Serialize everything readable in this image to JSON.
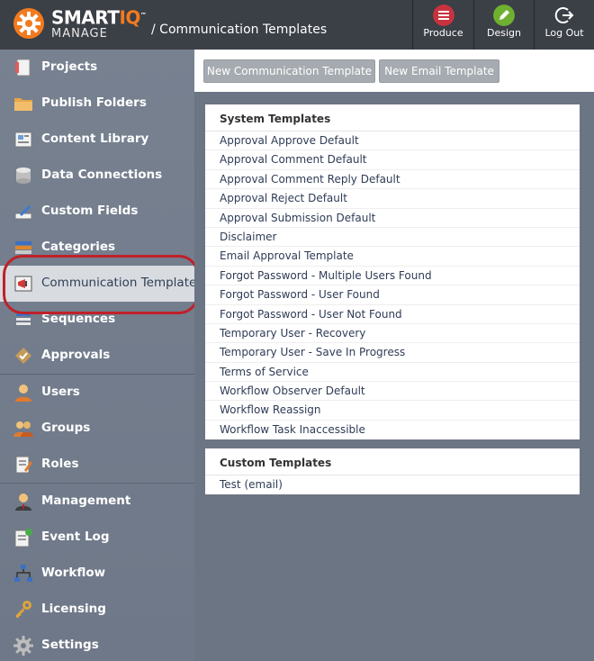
{
  "app": {
    "brand_main": "SMART",
    "brand_iq": "IQ",
    "brand_tm": "™",
    "brand_sub": "MANAGE",
    "page_title": "/ Communication Templates"
  },
  "header_buttons": [
    {
      "label": "Produce",
      "icon": "produce-icon",
      "color": "#c8323f"
    },
    {
      "label": "Design",
      "icon": "design-pencil-icon",
      "color": "#6fb030"
    },
    {
      "label": "Log Out",
      "icon": "logout-icon",
      "color": "#3b3f46"
    }
  ],
  "sidebar": {
    "items": [
      {
        "label": "Projects",
        "icon": "projects-icon"
      },
      {
        "label": "Publish Folders",
        "icon": "folder-icon"
      },
      {
        "label": "Content Library",
        "icon": "content-library-icon"
      },
      {
        "label": "Data Connections",
        "icon": "database-icon"
      },
      {
        "label": "Custom Fields",
        "icon": "custom-fields-icon"
      },
      {
        "label": "Categories",
        "icon": "categories-icon"
      },
      {
        "label": "Communication Templates",
        "icon": "megaphone-icon",
        "active": true
      },
      {
        "label": "Sequences",
        "icon": "sequences-icon"
      },
      {
        "label": "Approvals",
        "icon": "approvals-icon"
      },
      {
        "label": "Users",
        "icon": "user-icon"
      },
      {
        "label": "Groups",
        "icon": "groups-icon"
      },
      {
        "label": "Roles",
        "icon": "roles-icon"
      },
      {
        "label": "Management",
        "icon": "management-icon"
      },
      {
        "label": "Event Log",
        "icon": "event-log-icon"
      },
      {
        "label": "Workflow",
        "icon": "workflow-icon"
      },
      {
        "label": "Licensing",
        "icon": "key-icon"
      },
      {
        "label": "Settings",
        "icon": "gear-icon"
      }
    ]
  },
  "toolbar": {
    "new_comm_label": "New Communication Template",
    "new_email_label": "New Email Template"
  },
  "system_templates": {
    "title": "System Templates",
    "items": [
      "Approval Approve Default",
      "Approval Comment Default",
      "Approval Comment Reply Default",
      "Approval Reject Default",
      "Approval Submission Default",
      "Disclaimer",
      "Email Approval Template",
      "Forgot Password - Multiple Users Found",
      "Forgot Password - User Found",
      "Forgot Password - User Not Found",
      "Temporary User - Recovery",
      "Temporary User - Save In Progress",
      "Terms of Service",
      "Workflow Observer Default",
      "Workflow Reassign",
      "Workflow Task Inaccessible"
    ]
  },
  "custom_templates": {
    "title": "Custom Templates",
    "items": [
      "Test (email)"
    ]
  },
  "colors": {
    "accent_orange": "#f27a1f",
    "header_bg": "#3b3f46",
    "highlight_red": "#c0202a"
  }
}
